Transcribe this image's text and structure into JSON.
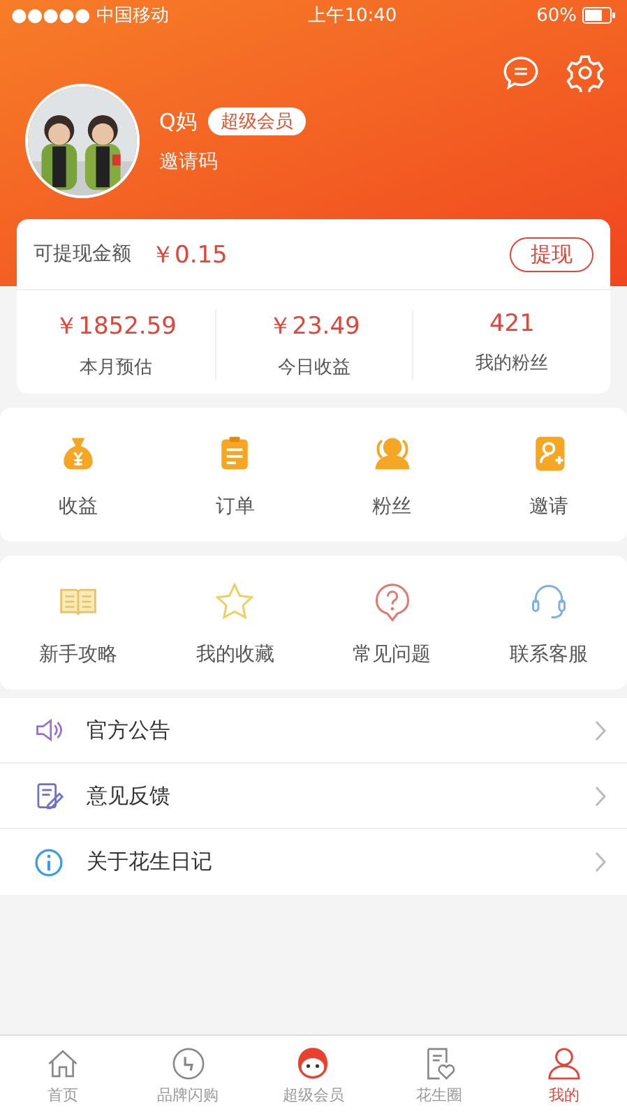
{
  "status_bar": {
    "carrier": "●●●●● 中国移动",
    "time": "上午10:40",
    "battery": "60%"
  },
  "profile": {
    "kind": "picture",
    "name": "Q妈",
    "badge": "超级会员",
    "invite_label": "邀请码"
  },
  "balance": {
    "label": "可提现金额",
    "amount": "￥0.15",
    "button": "提现"
  },
  "stats": [
    {
      "value": "￥1852.59",
      "label": "本月预估"
    },
    {
      "value": "￥23.49",
      "label": "今日收益"
    },
    {
      "value": "421",
      "label": "我的粉丝"
    }
  ],
  "main_actions": [
    {
      "kind": "moneybag",
      "label": "收益"
    },
    {
      "kind": "clipboard",
      "label": "订单"
    },
    {
      "kind": "people",
      "label": "粉丝"
    },
    {
      "kind": "contact",
      "label": "邀请"
    }
  ],
  "tools": [
    {
      "kind": "book",
      "label": "新手攻略"
    },
    {
      "kind": "star",
      "label": "我的收藏"
    },
    {
      "kind": "question",
      "label": "常见问题"
    },
    {
      "kind": "headset",
      "label": "联系客服"
    }
  ],
  "menu": [
    {
      "kind": "speaker",
      "label": "官方公告"
    },
    {
      "kind": "edit",
      "label": "意见反馈"
    },
    {
      "kind": "info",
      "label": "关于花生日记"
    }
  ],
  "tab_bar": [
    {
      "kind": "home",
      "label": "首页",
      "selected": false
    },
    {
      "kind": "flash",
      "label": "品牌闪购",
      "selected": false
    },
    {
      "kind": "mascot",
      "label": "超级会员",
      "selected": false
    },
    {
      "kind": "heart",
      "label": "花生圈",
      "selected": false
    },
    {
      "kind": "person",
      "label": "我的",
      "selected": true
    }
  ]
}
